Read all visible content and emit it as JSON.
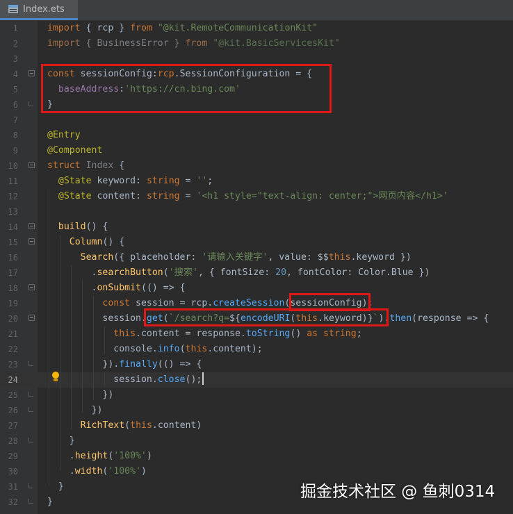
{
  "tab": {
    "filename": "Index.ets",
    "icon": "ets-file-icon"
  },
  "lines": [
    {
      "n": "1",
      "html": "<span class=\"kw\">import</span> { rcp } <span class=\"kw\">from</span> <span class=\"str\">\"@kit.RemoteCommunicationKit\"</span>"
    },
    {
      "n": "2",
      "html": "<span class=\"dimkw\">import</span><span class=\"dim\"> { BusinessError } </span><span class=\"dimkw\">from</span> <span class=\"dimstr\">\"@kit.BasicServicesKit\"</span>"
    },
    {
      "n": "3",
      "html": ""
    },
    {
      "n": "4",
      "html": "<span class=\"kw\">const</span> sessionConfig:<span class=\"kw\">rcp</span>.SessionConfiguration = {"
    },
    {
      "n": "5",
      "html": "  <span class=\"prop\">baseAddress</span>:<span class=\"str\">'https://cn.bing.com'</span>"
    },
    {
      "n": "6",
      "html": "}"
    },
    {
      "n": "7",
      "html": ""
    },
    {
      "n": "8",
      "html": "<span class=\"dec\">@Entry</span>"
    },
    {
      "n": "9",
      "html": "<span class=\"dec\">@Component</span>"
    },
    {
      "n": "10",
      "html": "<span class=\"kw\">struct</span> <span class=\"dim\">Index</span> {"
    },
    {
      "n": "11",
      "html": "  <span class=\"dec\">@State</span> keyword: <span class=\"kw\">string</span> = <span class=\"str\">''</span>;"
    },
    {
      "n": "12",
      "html": "  <span class=\"dec\">@State</span> content: <span class=\"kw\">string</span> = <span class=\"str\">'&lt;h1 style=\"text-align: center;\"&gt;网页内容&lt;/h1&gt;'</span>"
    },
    {
      "n": "13",
      "html": ""
    },
    {
      "n": "14",
      "html": "  <span class=\"fn\">build</span>() {"
    },
    {
      "n": "15",
      "html": "    <span class=\"fn\">Column</span>() {"
    },
    {
      "n": "16",
      "html": "      <span class=\"fn\">Search</span>({ placeholder: <span class=\"str\">'请输入关键字'</span>, value: $$<span class=\"kw\">this</span>.keyword })"
    },
    {
      "n": "17",
      "html": "        .<span class=\"fn\">searchButton</span>(<span class=\"str\">'搜索'</span>, { fontSize: <span class=\"num\">20</span>, fontColor: Color.Blue })"
    },
    {
      "n": "18",
      "html": "        .<span class=\"fn\">onSubmit</span>(() =&gt; {"
    },
    {
      "n": "19",
      "html": "          <span class=\"kw\">const</span> session = rcp.<span class=\"call\">createSession</span>(sessionConfig);"
    },
    {
      "n": "20",
      "html": "          session.<span class=\"call\">get</span>(<span class=\"str\">`/search?q=</span>${<span class=\"call\">encodeURI</span>(<span class=\"kw\">this</span>.keyword)}<span class=\"str\">`</span>).<span class=\"call\">then</span>(response =&gt; {"
    },
    {
      "n": "21",
      "html": "            <span class=\"kw\">this</span>.content = response.<span class=\"call\">toString</span>() <span class=\"kw\">as</span> <span class=\"kw\">string</span>;"
    },
    {
      "n": "22",
      "html": "            console.<span class=\"call\">info</span>(<span class=\"kw\">this</span>.content);"
    },
    {
      "n": "23",
      "html": "          }).<span class=\"call\">finally</span>(() =&gt; {"
    },
    {
      "n": "24",
      "html": "            session.<span class=\"call\">close</span>();"
    },
    {
      "n": "25",
      "html": "          })"
    },
    {
      "n": "26",
      "html": "        })"
    },
    {
      "n": "27",
      "html": "      <span class=\"fn\">RichText</span>(<span class=\"kw\">this</span>.content)"
    },
    {
      "n": "28",
      "html": "    }"
    },
    {
      "n": "29",
      "html": "    .<span class=\"fn\">height</span>(<span class=\"str\">'100%'</span>)"
    },
    {
      "n": "30",
      "html": "    .<span class=\"fn\">width</span>(<span class=\"str\">'100%'</span>)"
    },
    {
      "n": "31",
      "html": "  }"
    },
    {
      "n": "32",
      "html": "}"
    }
  ],
  "current_line": "24",
  "highlight_color": "#e01818",
  "watermark": "掘金技术社区 @ 鱼刺0314"
}
